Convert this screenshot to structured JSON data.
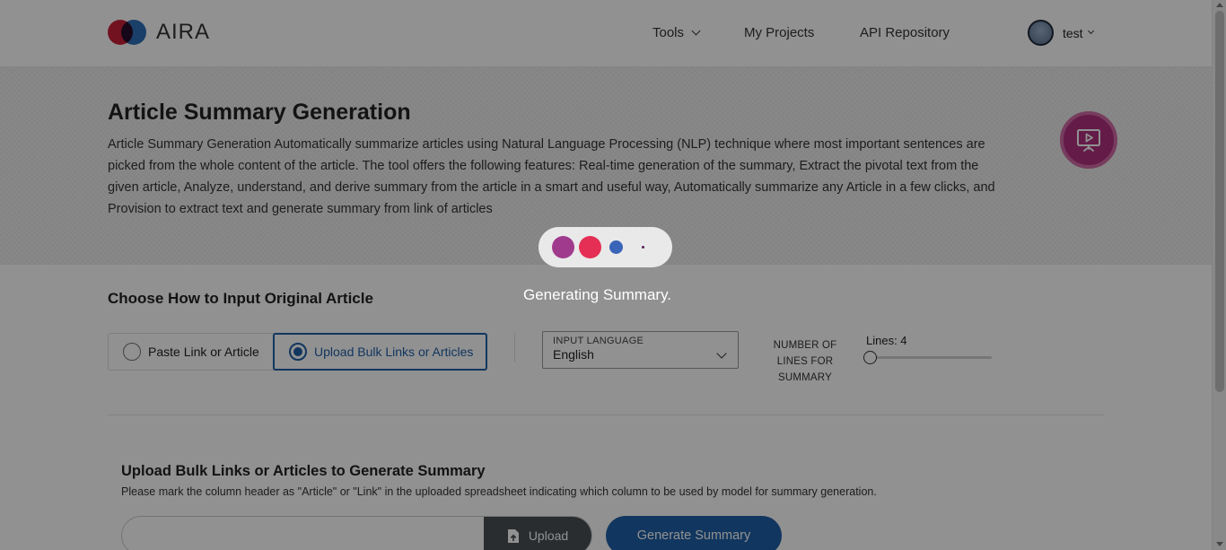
{
  "header": {
    "brand": "AIRA",
    "nav": {
      "tools": "Tools",
      "projects": "My Projects",
      "api": "API Repository"
    },
    "user": {
      "name": "test"
    }
  },
  "banner": {
    "title": "Article Summary Generation",
    "description": "Article Summary Generation Automatically summarize articles using Natural Language Processing (NLP) technique where most important sentences are picked from the whole content of the article. The tool offers the following features: Real-time generation of the summary, Extract the pivotal text from the given article, Analyze, understand, and derive summary from the article in a smart and useful way, Automatically summarize any Article in a few clicks, and Provision to extract text and generate summary from link of articles",
    "tour_icon": "presentation-play-icon"
  },
  "input_section": {
    "title": "Choose How to Input Original Article",
    "options": [
      {
        "label": "Paste Link or Article",
        "selected": false
      },
      {
        "label": "Upload Bulk Links or Articles",
        "selected": true
      }
    ],
    "language": {
      "label": "INPUT LANGUAGE",
      "value": "English"
    },
    "lines": {
      "label": "NUMBER OF LINES FOR SUMMARY",
      "value_text": "Lines: 4",
      "value": 4
    }
  },
  "upload_section": {
    "title": "Upload Bulk Links or Articles to Generate Summary",
    "hint": "Please mark the column header as \"Article\" or \"Link\" in the uploaded spreadsheet indicating which column to be used by model for summary generation.",
    "upload_label": "Upload",
    "generate_label": "Generate Summary"
  },
  "overlay": {
    "message": "Generating Summary."
  },
  "colors": {
    "primary": "#1f5fa8",
    "accent": "#b0317f",
    "loader_dots": [
      "#a03a8c",
      "#e52f54",
      "#3a64b8",
      "#5a1e5a"
    ]
  }
}
